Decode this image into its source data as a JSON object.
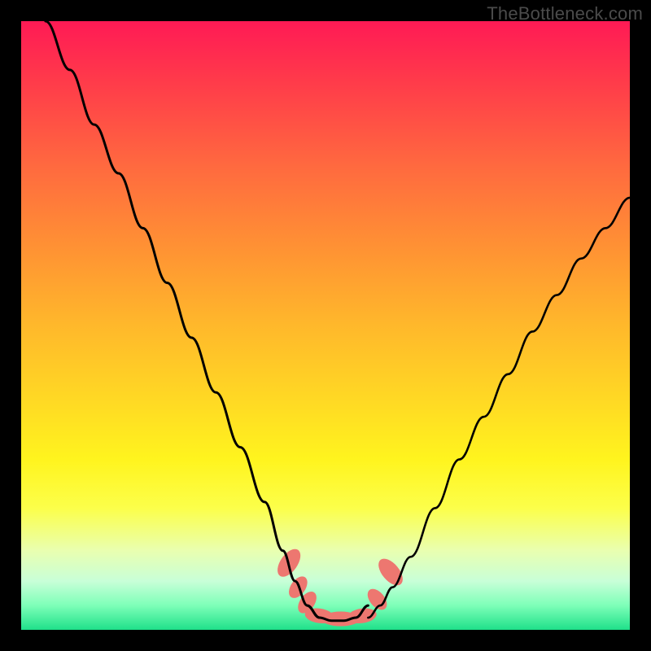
{
  "credit": "TheBottleneck.com",
  "chart_data": {
    "type": "line",
    "title": "",
    "xlabel": "",
    "ylabel": "",
    "xlim": [
      0,
      100
    ],
    "ylim": [
      0,
      100
    ],
    "grid": false,
    "legend": false,
    "series": [
      {
        "name": "left-curve",
        "x": [
          4,
          8,
          12,
          16,
          20,
          24,
          28,
          32,
          36,
          40,
          43,
          45,
          47,
          49
        ],
        "y": [
          100,
          92,
          83,
          75,
          66,
          57,
          48,
          39,
          30,
          21,
          13,
          8,
          4,
          2
        ]
      },
      {
        "name": "right-curve",
        "x": [
          57,
          59,
          61,
          64,
          68,
          72,
          76,
          80,
          84,
          88,
          92,
          96,
          100
        ],
        "y": [
          2,
          4,
          7,
          12,
          20,
          28,
          35,
          42,
          49,
          55,
          61,
          66,
          71
        ]
      },
      {
        "name": "trough",
        "x": [
          47,
          49,
          51,
          53,
          55,
          57
        ],
        "y": [
          4,
          2,
          1.5,
          1.5,
          2,
          4
        ]
      }
    ],
    "markers": [
      {
        "x": 44.0,
        "y": 11.0,
        "rx": 1.4,
        "ry": 2.6,
        "rot": 35
      },
      {
        "x": 45.5,
        "y": 7.0,
        "rx": 1.2,
        "ry": 2.0,
        "rot": 35
      },
      {
        "x": 47.0,
        "y": 4.5,
        "rx": 1.2,
        "ry": 2.0,
        "rot": 35
      },
      {
        "x": 49.0,
        "y": 2.3,
        "rx": 2.4,
        "ry": 1.2,
        "rot": 8
      },
      {
        "x": 52.5,
        "y": 1.8,
        "rx": 3.2,
        "ry": 1.2,
        "rot": 0
      },
      {
        "x": 56.0,
        "y": 2.3,
        "rx": 2.4,
        "ry": 1.2,
        "rot": -8
      },
      {
        "x": 58.5,
        "y": 5.0,
        "rx": 1.2,
        "ry": 2.0,
        "rot": -40
      },
      {
        "x": 60.7,
        "y": 9.5,
        "rx": 1.4,
        "ry": 2.6,
        "rot": -40
      }
    ],
    "colors": {
      "curve": "#000000",
      "marker": "#ed7770"
    }
  }
}
